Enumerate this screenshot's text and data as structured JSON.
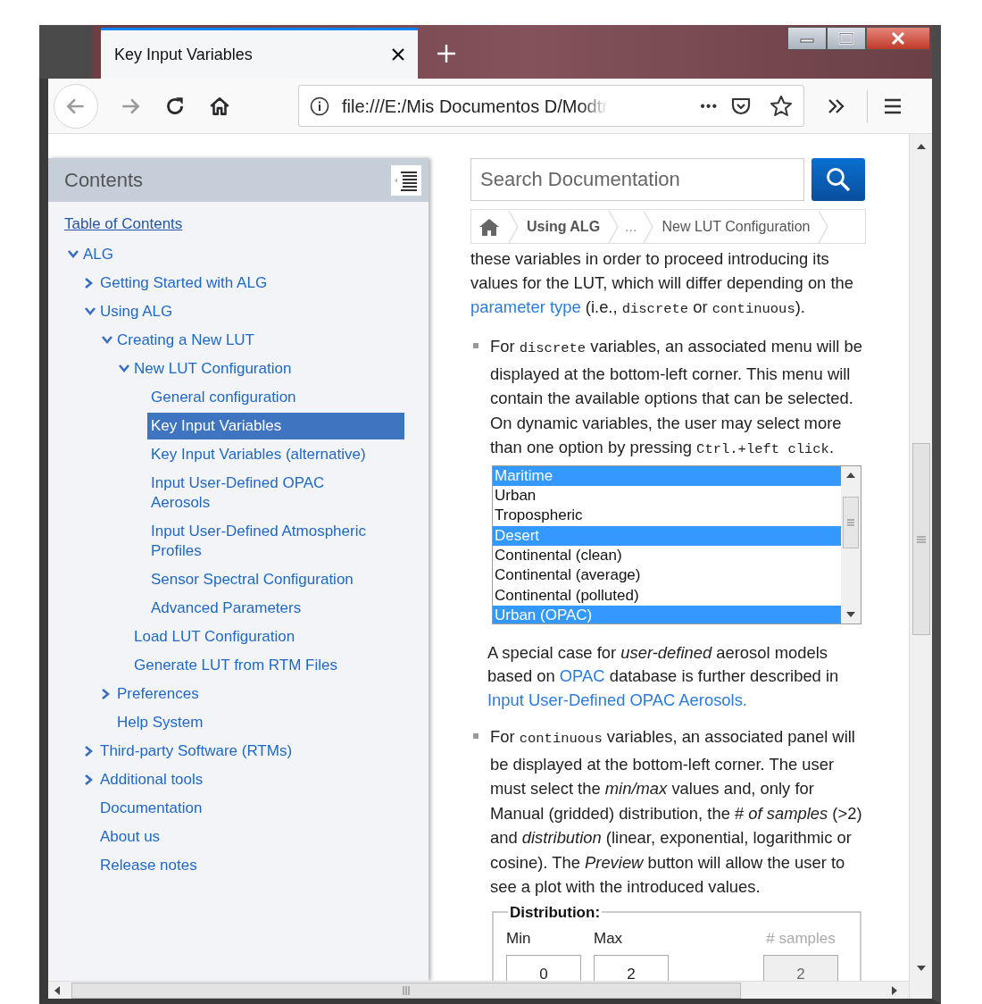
{
  "browser": {
    "tabs": [
      {
        "title": "Key Input Variables",
        "selected": true
      }
    ],
    "nav_buttons": [
      {
        "kind": "back",
        "disabled": true
      },
      {
        "kind": "forward",
        "disabled": true
      },
      {
        "kind": "reload",
        "disabled": false
      },
      {
        "kind": "home",
        "disabled": false
      }
    ],
    "address_bar": {
      "url": "file:///E:/Mis Documentos D/Modtr",
      "page_actions": "•••"
    }
  },
  "sidebar": {
    "title": "Contents",
    "toc_link": "Table of Contents",
    "items": [
      {
        "label": "ALG",
        "expanded": true,
        "selected": false,
        "children": [
          {
            "label": "Getting Started with ALG",
            "expanded": false,
            "selected": false
          },
          {
            "label": "Using ALG",
            "expanded": true,
            "selected": false,
            "children": [
              {
                "label": "Creating a New LUT",
                "expanded": true,
                "selected": false,
                "children": [
                  {
                    "label": "New LUT Configuration",
                    "expanded": true,
                    "selected": false,
                    "children": [
                      {
                        "label": "General configuration",
                        "selected": false
                      },
                      {
                        "label": "Key Input Variables",
                        "selected": true
                      },
                      {
                        "label": "Key Input Variables (alternative)",
                        "selected": false
                      },
                      {
                        "label": "Input User-Defined OPAC Aerosols",
                        "selected": false
                      },
                      {
                        "label": "Input User-Defined Atmospheric Profiles",
                        "selected": false
                      },
                      {
                        "label": "Sensor Spectral Configuration",
                        "selected": false
                      },
                      {
                        "label": "Advanced Parameters",
                        "selected": false
                      }
                    ]
                  },
                  {
                    "label": "Load LUT Configuration",
                    "selected": false
                  },
                  {
                    "label": "Generate LUT from RTM Files",
                    "selected": false
                  }
                ]
              },
              {
                "label": "Preferences",
                "expanded": false,
                "selected": false
              },
              {
                "label": "Help System",
                "selected": false
              }
            ]
          },
          {
            "label": "Third-party Software (RTMs)",
            "expanded": false,
            "selected": false
          },
          {
            "label": "Additional tools",
            "expanded": false,
            "selected": false
          },
          {
            "label": "Documentation",
            "selected": false
          },
          {
            "label": "About us",
            "selected": false
          },
          {
            "label": "Release notes",
            "selected": false
          }
        ]
      }
    ]
  },
  "search": {
    "placeholder": "Search Documentation"
  },
  "breadcrumb": [
    {
      "kind": "home"
    },
    {
      "kind": "section",
      "label": "Using ALG"
    },
    {
      "kind": "ellipsis",
      "label": "..."
    },
    {
      "kind": "page",
      "label": "New LUT Configuration"
    }
  ],
  "content": [
    {
      "kind": "paragraph",
      "runs": [
        {
          "kind": "text",
          "text": "these variables in order to proceed introducing its values for the LUT, which will differ depending on the "
        },
        {
          "kind": "link",
          "text": "parameter type"
        },
        {
          "kind": "text",
          "text": " (i.e., "
        },
        {
          "kind": "code",
          "text": "discrete"
        },
        {
          "kind": "text",
          "text": " or "
        },
        {
          "kind": "code",
          "text": "continuous"
        },
        {
          "kind": "text",
          "text": ")."
        }
      ]
    },
    {
      "kind": "bullet",
      "runs": [
        {
          "kind": "text",
          "text": "For "
        },
        {
          "kind": "code",
          "text": "discrete"
        },
        {
          "kind": "text",
          "text": " variables, an associated menu will be displayed at the bottom-left corner. This menu will contain the available options that can be selected. On dynamic variables, the user may select more than one option by pressing "
        },
        {
          "kind": "code",
          "text": "Ctrl.+left click"
        },
        {
          "kind": "text",
          "text": "."
        }
      ]
    },
    {
      "kind": "listbox",
      "options": [
        {
          "label": "Maritime",
          "selected": true
        },
        {
          "label": "Urban",
          "selected": false
        },
        {
          "label": "Tropospheric",
          "selected": false
        },
        {
          "label": "Desert",
          "selected": true
        },
        {
          "label": "Continental (clean)",
          "selected": false
        },
        {
          "label": "Continental (average)",
          "selected": false
        },
        {
          "label": "Continental (polluted)",
          "selected": false
        },
        {
          "label": "Urban (OPAC)",
          "selected": true
        }
      ]
    },
    {
      "kind": "note",
      "runs": [
        {
          "kind": "text",
          "text": "A special case for *user-defined* aerosol models based on "
        },
        {
          "kind": "link",
          "text": "OPAC"
        },
        {
          "kind": "text",
          "text": " database is further described in "
        },
        {
          "kind": "link",
          "text": "Input User-Defined OPAC Aerosols."
        }
      ]
    },
    {
      "kind": "bullet",
      "runs": [
        {
          "kind": "text",
          "text": "For "
        },
        {
          "kind": "code",
          "text": "continuous"
        },
        {
          "kind": "text",
          "text": " variables, an associated panel will be displayed at the bottom-left corner. The user must select the *min/max* values and, only for Manual (gridded) distribution, the # *of samples* (>2) and *distribution* (linear, exponential, logarithmic or cosine). The *Preview* button will allow the user to see a plot with the introduced values."
        }
      ]
    },
    {
      "kind": "fieldset",
      "legend": "Distribution:",
      "fields": [
        {
          "label": "Min",
          "value": "0",
          "disabled": false
        },
        {
          "label": "Max",
          "value": "2",
          "disabled": false
        },
        {
          "label": "# samples",
          "value": "2",
          "disabled": true
        }
      ]
    }
  ]
}
